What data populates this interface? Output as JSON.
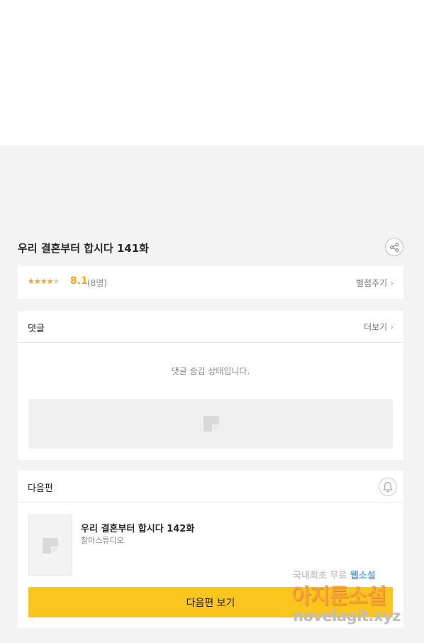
{
  "episode": {
    "title": "우리 결혼부터 합시다 141화"
  },
  "rating": {
    "stars_filled": 4,
    "stars_total": 5,
    "score": "8.1",
    "count": "(8명)",
    "rate_label": "별점주기"
  },
  "comments": {
    "header": "댓글",
    "more_label": "더보기",
    "hidden_message": "댓글 숨김 상태입니다."
  },
  "next_episode": {
    "header": "다음편",
    "title": "우리 결혼부터 합시다 142화",
    "studio": "찰아스튜디오",
    "button_label": "다음편 보기"
  },
  "watermark": {
    "line1_gray": "국내최초 무료 ",
    "line1_blue": "웹소설",
    "main": "아지툰소설",
    "url": "novelagit.xyz"
  },
  "colors": {
    "accent_yellow": "#fbc520",
    "star_orange": "#f0a71b",
    "background": "#f3f3f3"
  }
}
